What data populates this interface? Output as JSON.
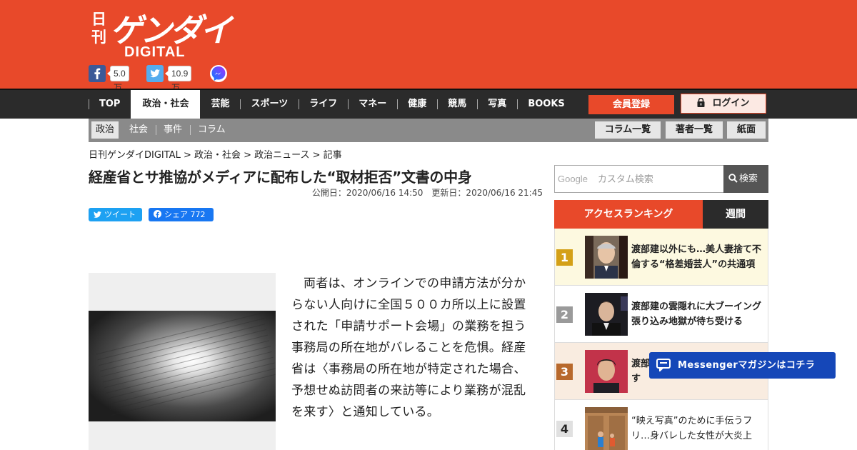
{
  "brand": {
    "logo_nikkan": "日刊",
    "logo_gendai": "ゲンダイ",
    "logo_digital": "DIGITAL",
    "color": "#e8492a"
  },
  "social": {
    "facebook_count": "5.0万",
    "twitter_count": "10.9万",
    "icons": [
      "facebook-icon",
      "twitter-icon",
      "messenger-icon"
    ]
  },
  "nav": {
    "items": [
      "TOP",
      "政治・社会",
      "芸能",
      "スポーツ",
      "ライフ",
      "マネー",
      "健康",
      "競馬",
      "写真",
      "BOOKS"
    ],
    "active": "政治・社会",
    "register_label": "会員登録",
    "login_label": "ログイン"
  },
  "subnav": {
    "items": [
      "政治",
      "社会",
      "事件",
      "コラム"
    ],
    "active": "政治",
    "buttons": [
      "コラム一覧",
      "著者一覧",
      "紙面"
    ]
  },
  "breadcrumb": "日刊ゲンダイDIGITAL > 政治・社会 > 政治ニュース > 記事",
  "article": {
    "title": "経産省とサ推協がメディアに配布した“取材拒否”文書の中身",
    "published": "公開日：2020/06/16 14:50　更新日：2020/06/16 21:45",
    "tweet_label": "ツイート",
    "share_label": "シェア",
    "share_count": "772",
    "body": "両者は、オンラインでの申請方法が分からない人向けに全国５００カ所以上に設置された「申請サポート会場」の業務を担う事務局の所在地がバレることを危惧。経産省は〈事務局の所在地が特定された場合、予想せぬ訪問者の来訪等により業務が混乱を来す〉と通知している。"
  },
  "search": {
    "brand": "Google",
    "placeholder": "カスタム検索",
    "button_label": "検索"
  },
  "ranking": {
    "tab_access": "アクセスランキング",
    "tab_weekly": "週間",
    "items": [
      {
        "rank": "1",
        "text": "渡部建以外にも…美人妻捨て不倫する“格差婚芸人”の共通項",
        "color": "#d4a017"
      },
      {
        "rank": "2",
        "text": "渡部建の雲隠れに大ブーイング 張り込み地獄が待ち受ける",
        "color": "#9a9a9a"
      },
      {
        "rank": "3",
        "text": "渡部…警察ロケでの夜遊びもです",
        "color": "#b8692c"
      },
      {
        "rank": "4",
        "text": "“映え写真”のために手伝うフリ…身バレした女性が大炎上",
        "color": "#e0e0e0"
      }
    ]
  },
  "messenger_banner": "Messengerマガジンはコチラ"
}
